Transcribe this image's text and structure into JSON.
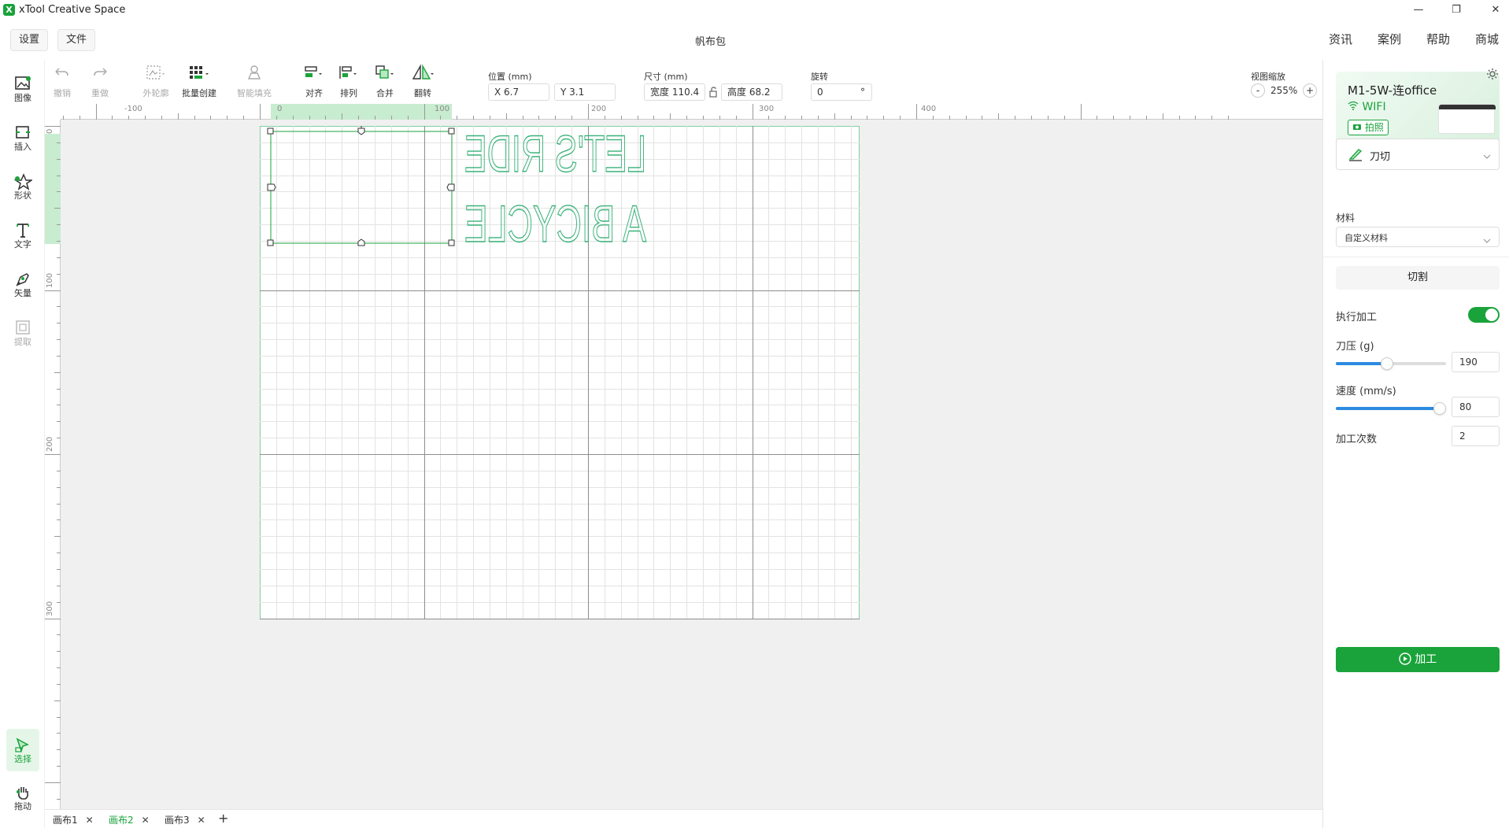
{
  "window": {
    "title": "xTool Creative Space",
    "logo_glyph": "X",
    "minimize": "—",
    "restore": "❐",
    "close": "✕"
  },
  "header": {
    "settings_label": "设置",
    "file_label": "文件",
    "project_title": "帆布包",
    "links": [
      "资讯",
      "案例",
      "帮助",
      "商城"
    ]
  },
  "toolbar": {
    "undo": "撤销",
    "redo": "重做",
    "outline": "外轮廓",
    "batch_create": "批量创建",
    "smart_fill": "智能填充",
    "align": "对齐",
    "arrange": "排列",
    "combine": "合并",
    "flip": "翻转",
    "position_label": "位置 (mm)",
    "x_value": "X 6.7",
    "y_value": "Y 3.1",
    "size_label": "尺寸 (mm)",
    "width_value": "宽度 110.4",
    "height_value": "高度 68.2",
    "rotate_label": "旋转",
    "rotate_value": "0",
    "rotate_unit": "°",
    "zoom_label": "视图缩放",
    "zoom_value": "255%",
    "zoom_out": "-",
    "zoom_in": "+"
  },
  "leftbar": {
    "image": "图像",
    "insert": "插入",
    "shape": "形状",
    "text": "文字",
    "vector": "矢量",
    "extract": "提取",
    "select": "选择",
    "drag": "拖动"
  },
  "rulers": {
    "h_labels": [
      "-100",
      "0",
      "100",
      "200",
      "300",
      "400"
    ],
    "v_labels": [
      "0",
      "100",
      "200",
      "300"
    ]
  },
  "canvas": {
    "line1": "LET'S RIDE",
    "line2": "A BICYCLE"
  },
  "tabs": {
    "items": [
      "画布1",
      "画布2",
      "画布3"
    ],
    "active_index": 1,
    "close_glyph": "✕",
    "add": "+"
  },
  "right_panel": {
    "device_name": "M1-5W-连office",
    "connection": "WIFI",
    "photo_button": "拍照",
    "mode": "刀切",
    "material_label": "材料",
    "material_value": "自定义材料",
    "operation_button": "切割",
    "enable_label": "执行加工",
    "enable_on": true,
    "pressure_label": "刀压 (g)",
    "pressure_value": "190",
    "speed_label": "速度 (mm/s)",
    "speed_value": "80",
    "passes_label": "加工次数",
    "passes_value": "2",
    "process_button": "加工"
  },
  "colors": {
    "accent": "#1aa33b",
    "slider": "#2b8be0",
    "selection_band": "#c8ecd0"
  },
  "icons": [
    "undo-icon",
    "redo-icon",
    "outline-icon",
    "batch-create-icon",
    "smart-fill-icon",
    "align-icon",
    "arrange-icon",
    "combine-icon",
    "flip-icon",
    "lock-icon",
    "image-icon",
    "insert-icon",
    "shape-icon",
    "text-icon",
    "vector-icon",
    "extract-icon",
    "select-icon",
    "hand-icon",
    "gear-icon",
    "wifi-icon",
    "camera-icon",
    "knife-icon",
    "chevron-down-icon",
    "play-icon"
  ]
}
